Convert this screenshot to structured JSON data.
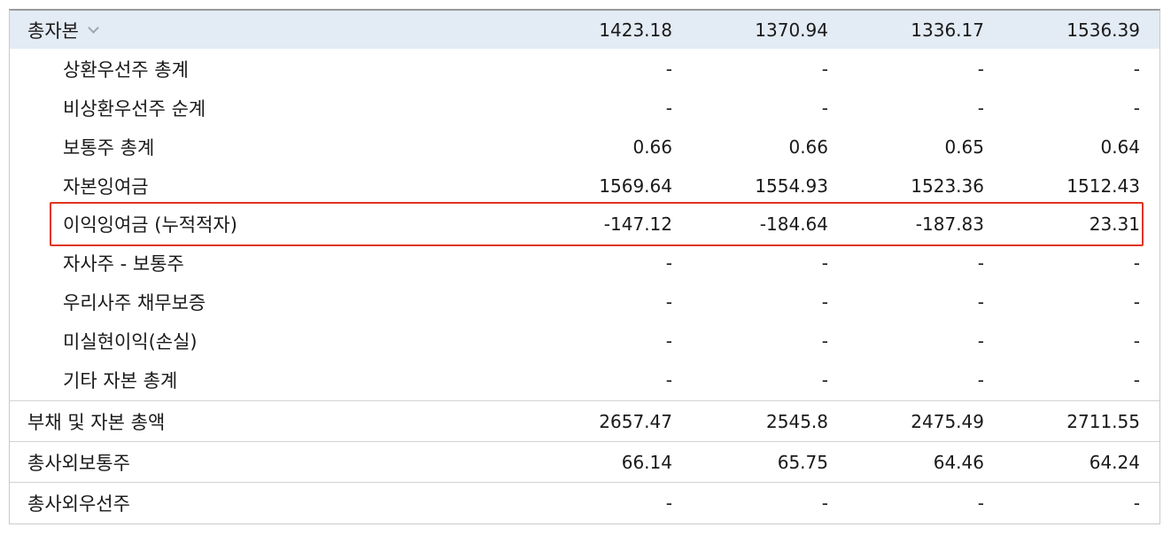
{
  "rows": [
    {
      "label": "총자본",
      "values": [
        "1423.18",
        "1370.94",
        "1336.17",
        "1536.39"
      ]
    },
    {
      "label": "상환우선주 총계",
      "values": [
        "-",
        "-",
        "-",
        "-"
      ]
    },
    {
      "label": "비상환우선주 순계",
      "values": [
        "-",
        "-",
        "-",
        "-"
      ]
    },
    {
      "label": "보통주 총계",
      "values": [
        "0.66",
        "0.66",
        "0.65",
        "0.64"
      ]
    },
    {
      "label": "자본잉여금",
      "values": [
        "1569.64",
        "1554.93",
        "1523.36",
        "1512.43"
      ]
    },
    {
      "label": "이익잉여금 (누적적자)",
      "values": [
        "-147.12",
        "-184.64",
        "-187.83",
        "23.31"
      ]
    },
    {
      "label": "자사주 - 보통주",
      "values": [
        "-",
        "-",
        "-",
        "-"
      ]
    },
    {
      "label": "우리사주 채무보증",
      "values": [
        "-",
        "-",
        "-",
        "-"
      ]
    },
    {
      "label": "미실현이익(손실)",
      "values": [
        "-",
        "-",
        "-",
        "-"
      ]
    },
    {
      "label": "기타 자본 총계",
      "values": [
        "-",
        "-",
        "-",
        "-"
      ]
    },
    {
      "label": "부채 및 자본 총액",
      "values": [
        "2657.47",
        "2545.8",
        "2475.49",
        "2711.55"
      ]
    },
    {
      "label": "총사외보통주",
      "values": [
        "66.14",
        "65.75",
        "64.46",
        "64.24"
      ]
    },
    {
      "label": "총사외우선주",
      "values": [
        "-",
        "-",
        "-",
        "-"
      ]
    }
  ],
  "highlight_color": "#e0341c",
  "header_row_bg": "#e3ebf4",
  "icons": {
    "expand": "chevron-down-icon"
  }
}
